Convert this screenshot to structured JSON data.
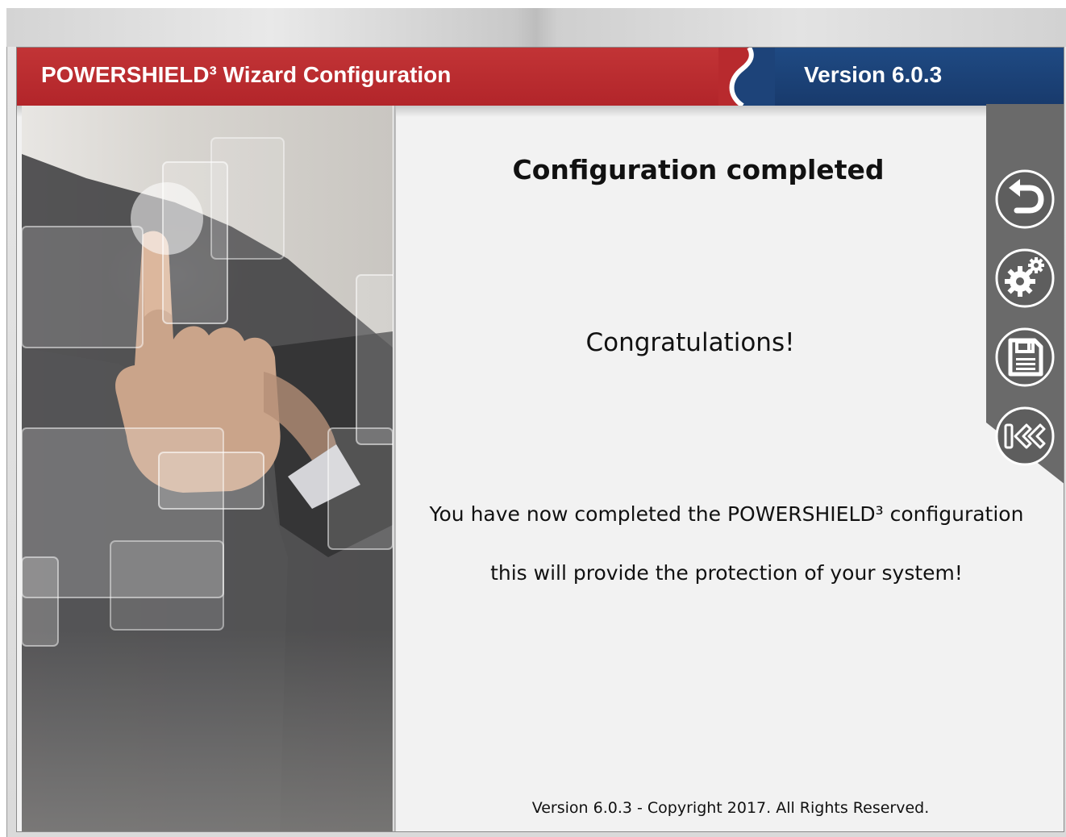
{
  "header": {
    "app_title": "POWERSHIELD³ Wizard Configuration",
    "version": "Version 6.0.3"
  },
  "main": {
    "page_title": "Configuration completed",
    "congratulations": "Congratulations!",
    "message_line1": "You have now completed the POWERSHIELD³ configuration",
    "message_line2": "this will provide the protection of your system!",
    "footer": "Version 6.0.3 - Copyright 2017. All Rights Reserved."
  },
  "toolbar": {
    "buttons": [
      {
        "icon": "undo-arrow-icon"
      },
      {
        "icon": "gears-icon"
      },
      {
        "icon": "floppy-save-icon"
      },
      {
        "icon": "rewind-start-icon"
      }
    ]
  },
  "colors": {
    "header_red": "#b82a2e",
    "header_blue": "#1d4379",
    "toolbar_gray": "#6a6a6a",
    "content_bg": "#f2f2f2"
  }
}
